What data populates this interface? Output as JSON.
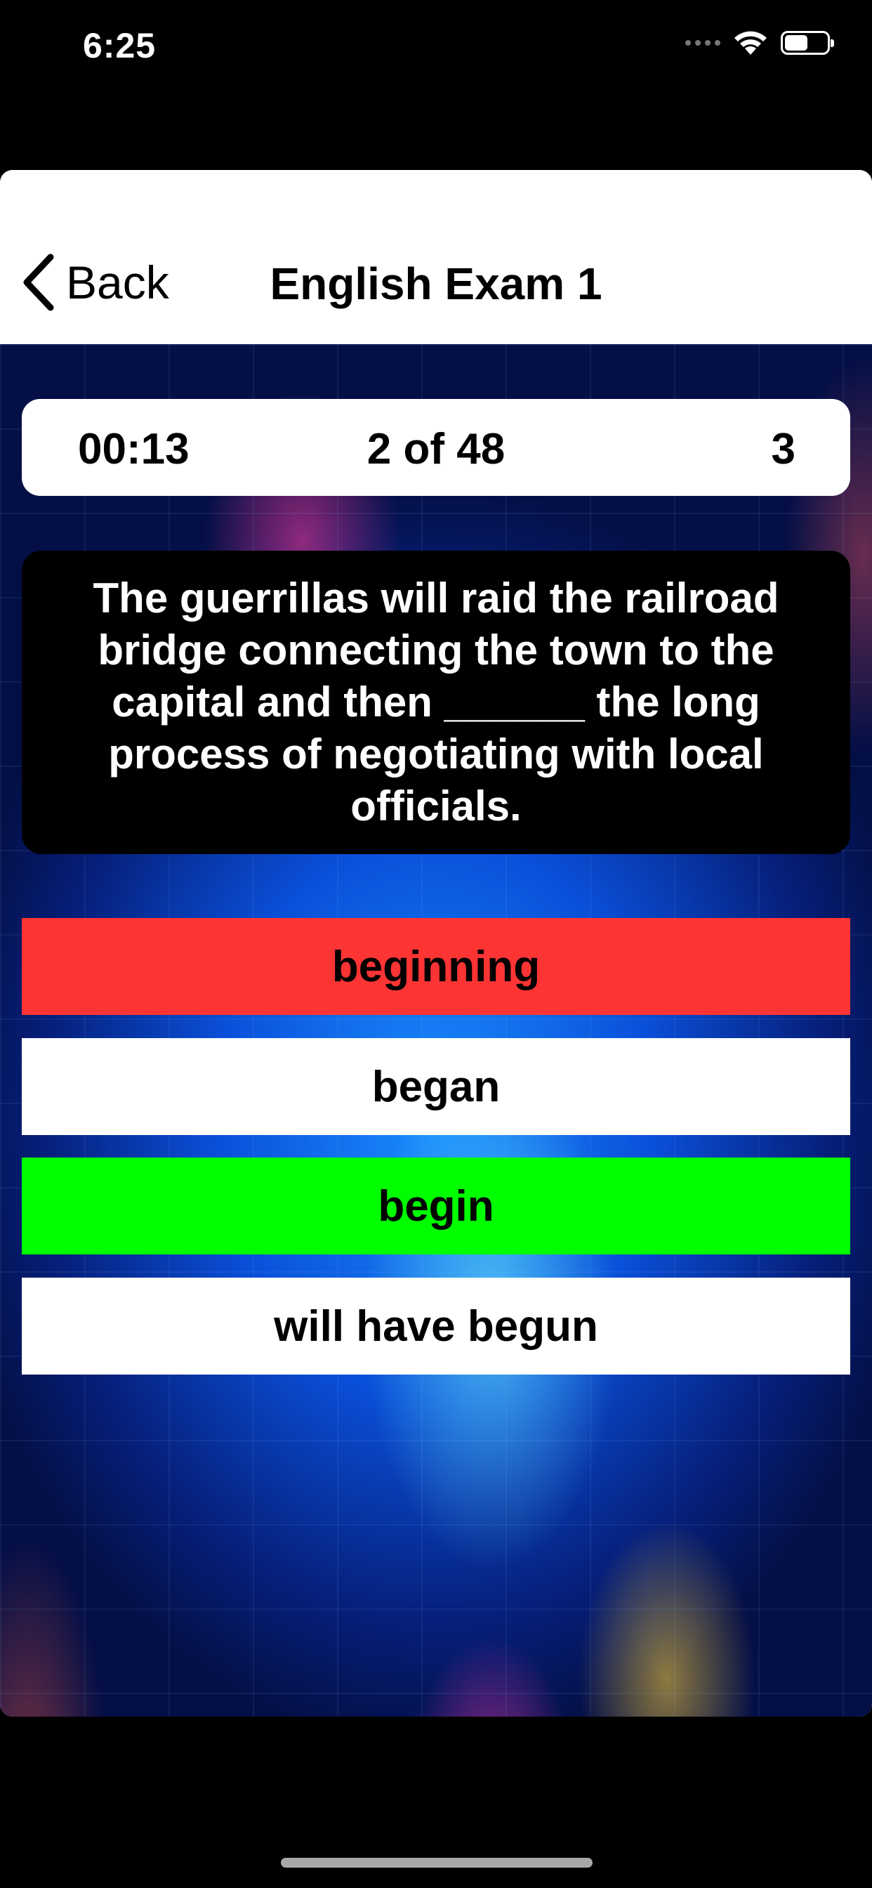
{
  "status_bar": {
    "time": "6:25",
    "icons": [
      "signal-icon",
      "wifi-icon",
      "battery-icon"
    ]
  },
  "nav": {
    "back_label": "Back",
    "title": "English Exam 1"
  },
  "info_bar": {
    "timer": "00:13",
    "progress": "2 of 48",
    "score": "3"
  },
  "question": {
    "text": "The guerrillas will raid the railroad bridge connecting the town to the capital and then ______ the long process of negotiating with local officials."
  },
  "answers": [
    {
      "label": "beginning",
      "state": "wrong",
      "color": "#fd3434"
    },
    {
      "label": "began",
      "state": "neutral",
      "color": "#ffffff"
    },
    {
      "label": "begin",
      "state": "correct",
      "color": "#00fe00"
    },
    {
      "label": "will have begun",
      "state": "neutral",
      "color": "#ffffff"
    }
  ]
}
